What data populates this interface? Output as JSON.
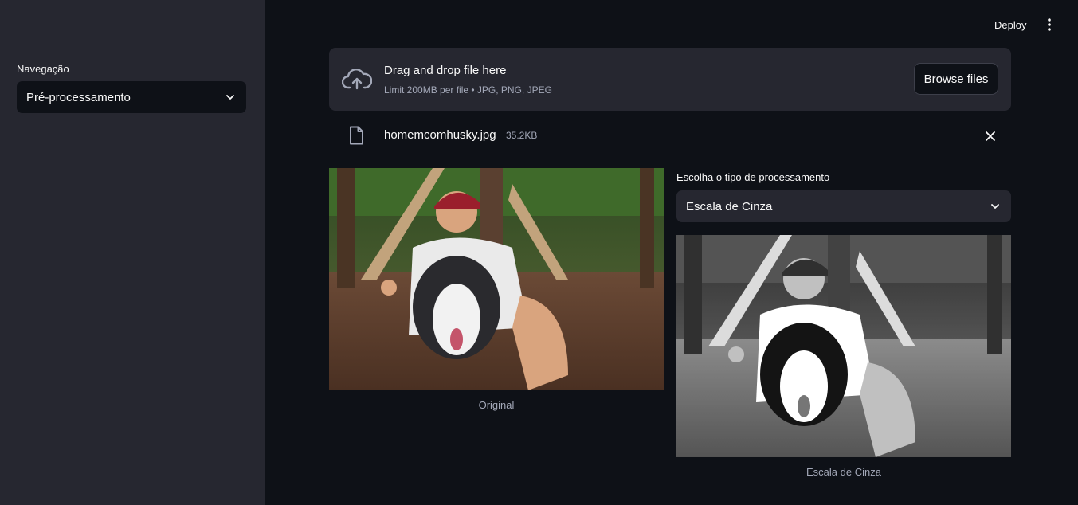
{
  "sidebar": {
    "label": "Navegação",
    "select_value": "Pré-processamento"
  },
  "header": {
    "deploy_label": "Deploy"
  },
  "uploader": {
    "title": "Drag and drop file here",
    "limit": "Limit 200MB per file • JPG, PNG, JPEG",
    "browse_label": "Browse files"
  },
  "file": {
    "name": "homemcomhusky.jpg",
    "size": "35.2KB"
  },
  "images": {
    "original_caption": "Original",
    "processed_caption": "Escala de Cinza"
  },
  "processing": {
    "label": "Escolha o tipo de processamento",
    "select_value": "Escala de Cinza"
  },
  "colors": {
    "background": "#0e1117",
    "sidebar": "#262730",
    "text": "#fafafa",
    "muted": "#a3a8b8"
  }
}
